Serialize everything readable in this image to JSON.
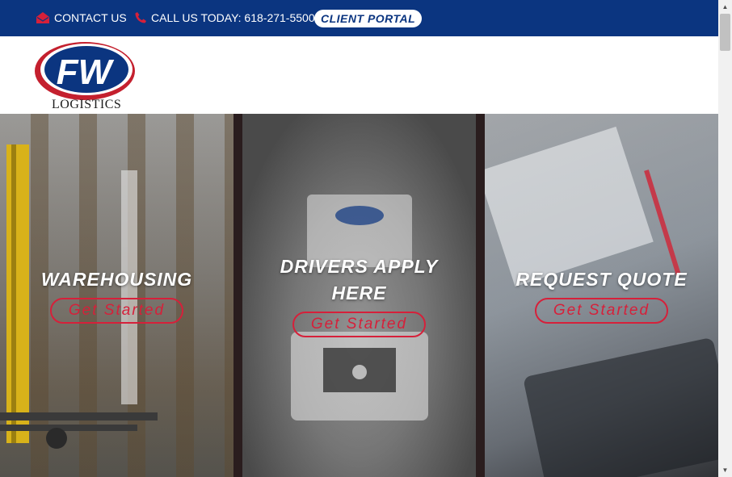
{
  "topbar": {
    "contact_label": "CONTACT US",
    "call_label": "CALL US TODAY: 618-271-5500",
    "portal_label": "CLIENT PORTAL"
  },
  "header": {
    "logo_letters": "FW",
    "logo_subtext": "LOGISTICS"
  },
  "panels": [
    {
      "title": "WAREHOUSING",
      "button": "Get Started"
    },
    {
      "title_line1": "DRIVERS APPLY",
      "title_line2": "HERE",
      "button": "Get Started"
    },
    {
      "title": "REQUEST QUOTE",
      "button": "Get Started"
    }
  ],
  "colors": {
    "brand_blue": "#0b3580",
    "accent_red": "#d6203a"
  },
  "icons": {
    "contact": "envelope-open-icon",
    "call": "phone-icon"
  }
}
